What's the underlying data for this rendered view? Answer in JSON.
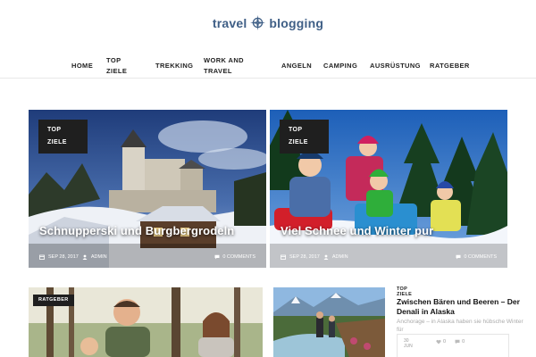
{
  "logo": {
    "word1": "travel",
    "word2": "blogging"
  },
  "nav": [
    {
      "label": "Home"
    },
    {
      "label": "Top Ziele"
    },
    {
      "label": "Trekking"
    },
    {
      "label": "Work and Travel"
    },
    {
      "label": "Angeln"
    },
    {
      "label": "Camping"
    },
    {
      "label": "Ausrüstung"
    },
    {
      "label": "Ratgeber"
    }
  ],
  "featured": [
    {
      "category": "TOP ZIELE",
      "title": "Schnupperski und Burgbergrodeln",
      "date": "SEP 28, 2017",
      "author": "ADMIN",
      "comments": "0 COMMENTS"
    },
    {
      "category": "TOP ZIELE",
      "title": "Viel Schnee und Winter pur",
      "date": "SEP 28, 2017",
      "author": "ADMIN",
      "comments": "0 COMMENTS"
    }
  ],
  "bottom_left": {
    "category": "RATGEBER"
  },
  "right_article": {
    "category": "TOP ZIELE",
    "title": "Zwischen Bären und Beeren – Der Denali in Alaska",
    "excerpt": "Anchorage – in Alaska haben sie hübsche Winter für",
    "date_day": "30",
    "date_month": "JUN",
    "likes": "0",
    "comments": "0"
  },
  "colors": {
    "logo": "#3f5f86",
    "tag_bg": "#1f1f1f"
  }
}
